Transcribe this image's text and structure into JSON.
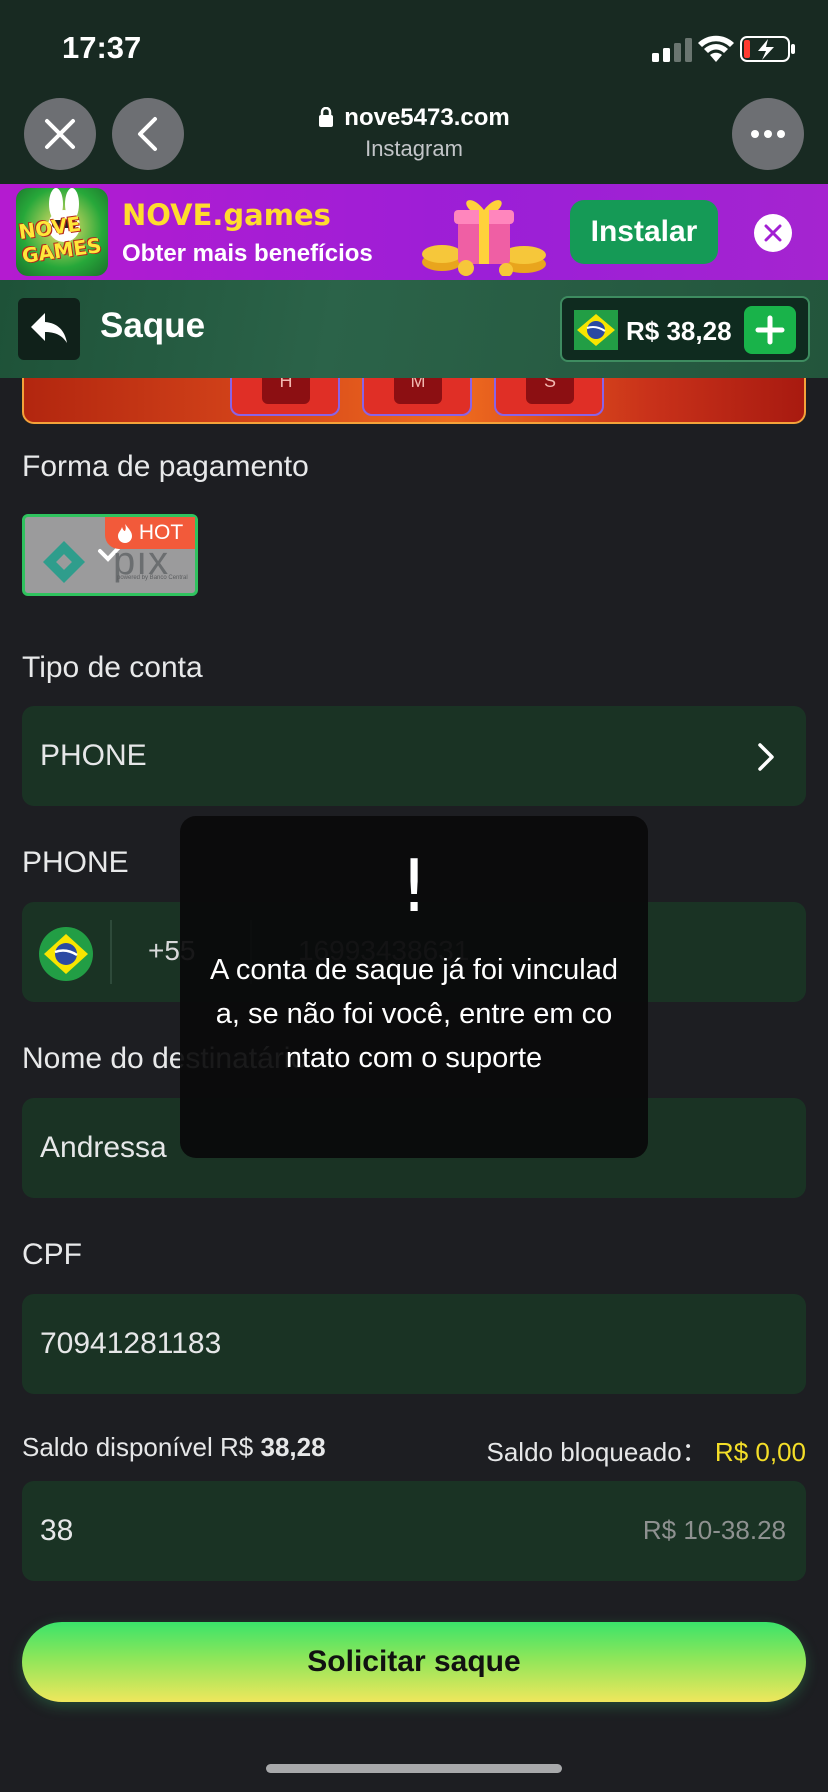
{
  "status_bar": {
    "time": "17:37"
  },
  "browser": {
    "domain": "nove5473.com",
    "source": "Instagram"
  },
  "banner": {
    "title": "NOVE.games",
    "subtitle": "Obter mais benefícios",
    "install_label": "Instalar",
    "logo_text": "NOVE GAMES"
  },
  "header": {
    "title": "Saque",
    "balance": "R$ 38,28"
  },
  "game_tiles": [
    "H",
    "M",
    "S"
  ],
  "payment": {
    "label": "Forma de pagamento",
    "method": "pix",
    "badge": "HOT",
    "pix_caption": "powered by Banco Central"
  },
  "account_type": {
    "label": "Tipo de conta",
    "value": "PHONE"
  },
  "phone": {
    "label": "PHONE",
    "country_code": "+55",
    "number": "16993438631"
  },
  "recipient": {
    "label": "Nome do destinatário",
    "value": "Andressa"
  },
  "cpf": {
    "label": "CPF",
    "value": "70941281183"
  },
  "balances": {
    "available_label": "Saldo disponível R$",
    "available_value": "38,28",
    "blocked_label": "Saldo bloqueado：",
    "blocked_value": "R$ 0,00"
  },
  "amount": {
    "value": "38",
    "range": "R$ 10-38.28"
  },
  "submit_label": "Solicitar saque",
  "toast": {
    "icon": "!",
    "message": "A conta de saque já foi vinculada, se não foi você, entre em contato com o suporte"
  },
  "colors": {
    "accent_green": "#19b34a",
    "warning_yellow": "#f4de28",
    "field_bg": "#1a3324"
  }
}
